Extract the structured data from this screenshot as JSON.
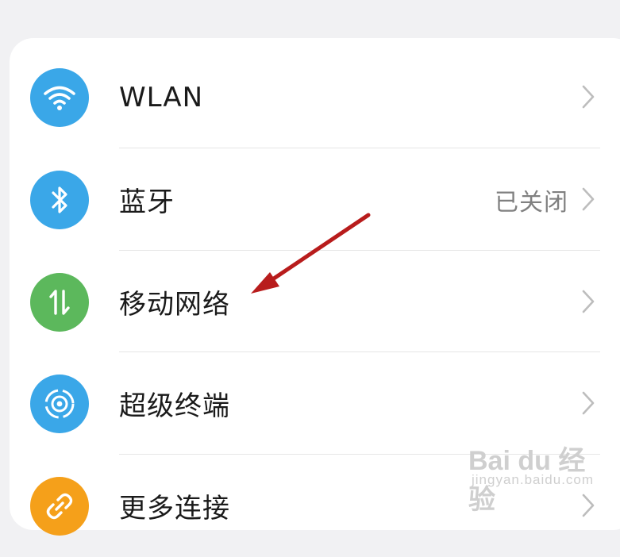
{
  "settings_list": [
    {
      "label": "WLAN",
      "value": "",
      "icon": "wifi-icon",
      "icon_color": "#3aa7e8"
    },
    {
      "label": "蓝牙",
      "value": "已关闭",
      "icon": "bluetooth-icon",
      "icon_color": "#3aa7e8"
    },
    {
      "label": "移动网络",
      "value": "",
      "icon": "mobile-data-icon",
      "icon_color": "#5cb85c"
    },
    {
      "label": "超级终端",
      "value": "",
      "icon": "super-device-icon",
      "icon_color": "#3aa7e8"
    },
    {
      "label": "更多连接",
      "value": "",
      "icon": "link-icon",
      "icon_color": "#f5a01a"
    }
  ],
  "annotation": {
    "color": "#b81c1c"
  },
  "watermark": {
    "main": "Bai du 经验",
    "sub": "jingyan.baidu.com"
  }
}
